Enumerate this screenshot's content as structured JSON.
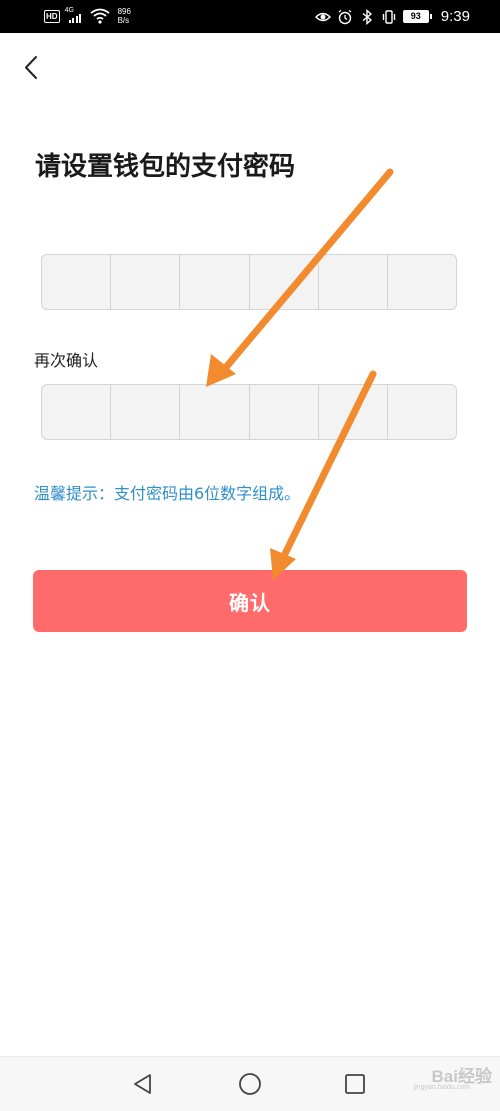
{
  "status_bar": {
    "hd": "HD",
    "network": "4G",
    "net_speed_value": "896",
    "net_speed_unit": "B/s",
    "battery": "93",
    "time": "9:39",
    "icons": [
      "eye-icon",
      "alarm-icon",
      "bluetooth-icon",
      "vibrate-icon"
    ]
  },
  "header": {
    "back_icon": "chevron-left-icon"
  },
  "title": "请设置钱包的支付密码",
  "pin_entry": {
    "length": 6
  },
  "confirm_pin": {
    "label": "再次确认",
    "length": 6
  },
  "hint": "温馨提示：支付密码由6位数字组成。",
  "confirm_button": {
    "label": "确认",
    "color": "#ff6a6a"
  },
  "colors": {
    "hint": "#2f8fc9",
    "annotation_arrow": "#f28a2e"
  },
  "nav_bar": {
    "icons": [
      "triangle-back-icon",
      "circle-home-icon",
      "square-recents-icon"
    ]
  },
  "watermark": {
    "text": "Bai经验",
    "sub": "jingyan.baidu.com"
  }
}
